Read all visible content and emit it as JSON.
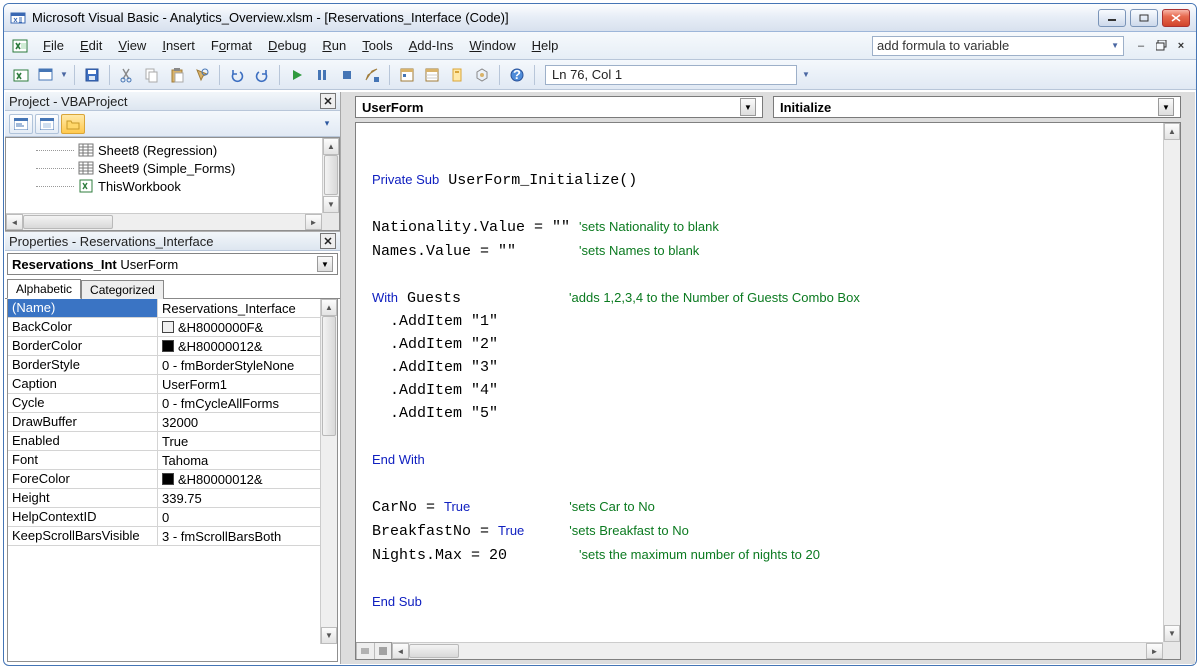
{
  "titlebar": {
    "title": "Microsoft Visual Basic - Analytics_Overview.xlsm - [Reservations_Interface (Code)]"
  },
  "menubar": {
    "items": [
      "File",
      "Edit",
      "View",
      "Insert",
      "Format",
      "Debug",
      "Run",
      "Tools",
      "Add-Ins",
      "Window",
      "Help"
    ],
    "question_box": "add formula to variable"
  },
  "toolbar": {
    "position": "Ln 76, Col 1"
  },
  "project_pane": {
    "title": "Project - VBAProject",
    "tree": [
      {
        "icon": "sheet",
        "label": "Sheet8 (Regression)"
      },
      {
        "icon": "sheet",
        "label": "Sheet9 (Simple_Forms)"
      },
      {
        "icon": "workbook",
        "label": "ThisWorkbook"
      }
    ]
  },
  "properties_pane": {
    "title": "Properties - Reservations_Interface",
    "object_name": "Reservations_Int",
    "object_type": "UserForm",
    "tabs": [
      "Alphabetic",
      "Categorized"
    ],
    "rows": [
      {
        "name": "(Name)",
        "value": "Reservations_Interface",
        "sel": true
      },
      {
        "name": "BackColor",
        "value": "&H8000000F&",
        "swatch": "#f0f0f0"
      },
      {
        "name": "BorderColor",
        "value": "&H80000012&",
        "swatch": "#000000"
      },
      {
        "name": "BorderStyle",
        "value": "0 - fmBorderStyleNone"
      },
      {
        "name": "Caption",
        "value": "UserForm1"
      },
      {
        "name": "Cycle",
        "value": "0 - fmCycleAllForms"
      },
      {
        "name": "DrawBuffer",
        "value": "32000"
      },
      {
        "name": "Enabled",
        "value": "True"
      },
      {
        "name": "Font",
        "value": "Tahoma"
      },
      {
        "name": "ForeColor",
        "value": "&H80000012&",
        "swatch": "#000000"
      },
      {
        "name": "Height",
        "value": "339.75"
      },
      {
        "name": "HelpContextID",
        "value": "0"
      },
      {
        "name": "KeepScrollBarsVisible",
        "value": "3 - fmScrollBarsBoth"
      }
    ]
  },
  "code_pane": {
    "object_combo": "UserForm",
    "proc_combo": "Initialize",
    "lines": [
      {
        "t": "blank"
      },
      {
        "t": "kw_plain",
        "kw": "Private Sub",
        "rest": " UserForm_Initialize()"
      },
      {
        "t": "blank"
      },
      {
        "t": "plain_cm",
        "plain": "Nationality.Value = \"\" ",
        "cm": "'sets Nationality to blank"
      },
      {
        "t": "plain_cm",
        "plain": "Names.Value = \"\"       ",
        "cm": "'sets Names to blank"
      },
      {
        "t": "blank"
      },
      {
        "t": "kw_plain_cm",
        "kw": "With",
        "rest": " Guests            ",
        "cm": "'adds 1,2,3,4 to the Number of Guests Combo Box"
      },
      {
        "t": "plain",
        "plain": "  .AddItem \"1\""
      },
      {
        "t": "plain",
        "plain": "  .AddItem \"2\""
      },
      {
        "t": "plain",
        "plain": "  .AddItem \"3\""
      },
      {
        "t": "plain",
        "plain": "  .AddItem \"4\""
      },
      {
        "t": "plain",
        "plain": "  .AddItem \"5\""
      },
      {
        "t": "blank"
      },
      {
        "t": "kw",
        "kw": "End With"
      },
      {
        "t": "blank"
      },
      {
        "t": "plain_kw_cm",
        "plain": "CarNo = ",
        "kw": "True",
        "pad": "           ",
        "cm": "'sets Car to No"
      },
      {
        "t": "plain_kw_cm",
        "plain": "BreakfastNo = ",
        "kw": "True",
        "pad": "     ",
        "cm": "'sets Breakfast to No"
      },
      {
        "t": "plain_cm",
        "plain": "Nights.Max = 20        ",
        "cm": "'sets the maximum number of nights to 20"
      },
      {
        "t": "blank"
      },
      {
        "t": "kw",
        "kw": "End Sub"
      }
    ]
  }
}
